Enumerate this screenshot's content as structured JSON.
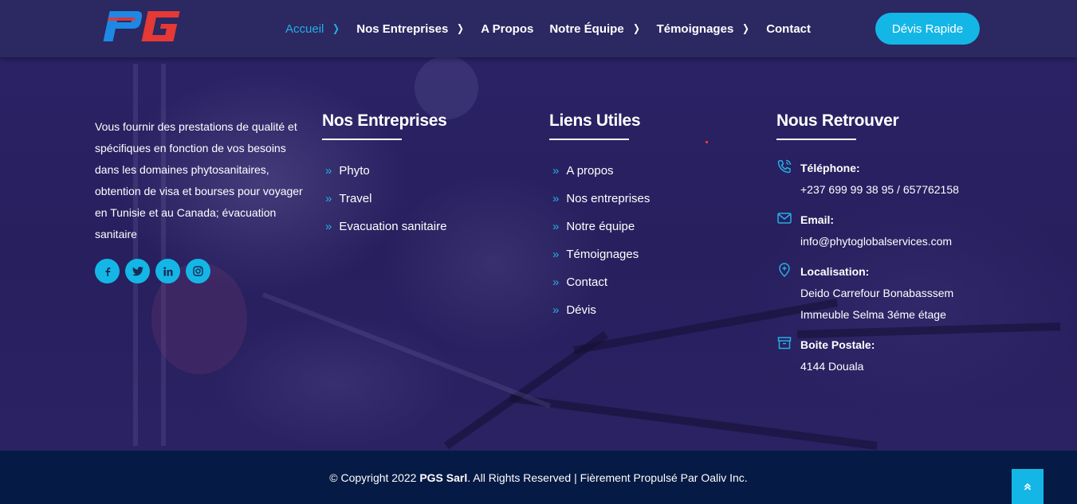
{
  "brand": {
    "logo_text": "PG",
    "logo_text_2": "G",
    "primary": "#14b6e6",
    "accent": "#e53935"
  },
  "nav": {
    "items": [
      {
        "label": "Accueil",
        "has_chevron": true
      },
      {
        "label": "Nos Entreprises",
        "has_chevron": true
      },
      {
        "label": "A Propos",
        "has_chevron": false
      },
      {
        "label": "Notre Équipe",
        "has_chevron": true
      },
      {
        "label": "Témoignages",
        "has_chevron": true
      },
      {
        "label": "Contact",
        "has_chevron": false
      }
    ],
    "cta": "Dévis Rapide"
  },
  "about": {
    "text": "Vous fournir des prestations de qualité et spécifiques en fonction de vos besoins dans les domaines phytosanitaires, obtention de visa et bourses pour voyager en Tunisie et au Canada; évacuation sanitaire",
    "socials": [
      {
        "icon": "facebook-icon",
        "glyph": "f"
      },
      {
        "icon": "twitter-icon",
        "glyph": "t"
      },
      {
        "icon": "linkedin-icon",
        "glyph": "in"
      },
      {
        "icon": "instagram-icon",
        "glyph": "◎"
      }
    ]
  },
  "entreprises": {
    "title": "Nos Entreprises",
    "links": [
      "Phyto",
      "Travel",
      "Evacuation sanitaire"
    ]
  },
  "liens": {
    "title": "Liens Utiles",
    "links": [
      "A propos",
      "Nos entreprises",
      "Notre équipe",
      "Témoignages",
      "Contact",
      "Dévis"
    ]
  },
  "retrouver": {
    "title": "Nous Retrouver",
    "items": [
      {
        "icon": "phone-icon",
        "label": "Téléphone:",
        "lines": [
          "+237 699 99 38 95 / 657762158"
        ]
      },
      {
        "icon": "email-icon",
        "label": "Email:",
        "lines": [
          "info@phytoglobalservices.com"
        ]
      },
      {
        "icon": "location-icon",
        "label": "Localisation:",
        "lines": [
          "Deido Carrefour Bonabasssem",
          "Immeuble Selma 3éme étage"
        ]
      },
      {
        "icon": "archive-icon",
        "label": "Boite Postale:",
        "lines": [
          "4144 Douala"
        ]
      }
    ]
  },
  "footer": {
    "copy_prefix": "© Copyright 2022",
    "company": "PGS Sarl",
    "copy_suffix": ". All Rights Reserved | Fièrement Propulsé Par Oaliv Inc."
  }
}
